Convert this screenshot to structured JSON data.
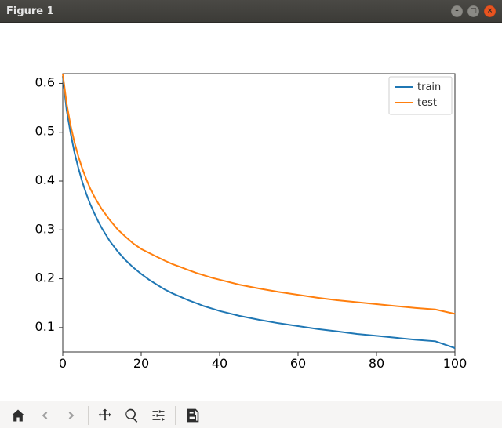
{
  "window": {
    "title": "Figure 1",
    "buttons": {
      "min": "–",
      "max": "▢",
      "close": "×"
    }
  },
  "toolbar": {
    "home": {
      "name": "home-icon",
      "title": "Home"
    },
    "back": {
      "name": "back-icon",
      "title": "Back"
    },
    "forward": {
      "name": "forward-icon",
      "title": "Forward"
    },
    "pan": {
      "name": "move-icon",
      "title": "Pan"
    },
    "zoom": {
      "name": "zoom-icon",
      "title": "Zoom"
    },
    "config": {
      "name": "sliders-icon",
      "title": "Configure subplots"
    },
    "save": {
      "name": "save-icon",
      "title": "Save"
    }
  },
  "chart_data": {
    "type": "line",
    "title": "",
    "xlabel": "",
    "ylabel": "",
    "xlim": [
      0,
      100
    ],
    "ylim": [
      0.05,
      0.62
    ],
    "xticks": [
      0,
      20,
      40,
      60,
      80,
      100
    ],
    "yticks": [
      0.1,
      0.2,
      0.3,
      0.4,
      0.5,
      0.6
    ],
    "x": [
      0,
      1,
      2,
      3,
      4,
      5,
      6,
      7,
      8,
      9,
      10,
      12,
      14,
      16,
      18,
      20,
      22,
      24,
      26,
      28,
      30,
      32,
      34,
      36,
      38,
      40,
      45,
      50,
      55,
      60,
      65,
      70,
      75,
      80,
      85,
      90,
      95,
      100
    ],
    "series": [
      {
        "name": "train",
        "color": "#1f77b4",
        "values": [
          0.615,
          0.545,
          0.498,
          0.458,
          0.426,
          0.398,
          0.374,
          0.353,
          0.335,
          0.318,
          0.303,
          0.277,
          0.256,
          0.238,
          0.223,
          0.21,
          0.198,
          0.188,
          0.178,
          0.17,
          0.163,
          0.156,
          0.15,
          0.144,
          0.139,
          0.134,
          0.124,
          0.116,
          0.109,
          0.103,
          0.097,
          0.092,
          0.087,
          0.083,
          0.079,
          0.075,
          0.072,
          0.058
        ]
      },
      {
        "name": "test",
        "color": "#ff7f0e",
        "values": [
          0.62,
          0.558,
          0.514,
          0.479,
          0.45,
          0.425,
          0.404,
          0.385,
          0.369,
          0.355,
          0.342,
          0.32,
          0.301,
          0.286,
          0.272,
          0.261,
          0.253,
          0.245,
          0.237,
          0.23,
          0.224,
          0.218,
          0.212,
          0.207,
          0.202,
          0.198,
          0.188,
          0.18,
          0.173,
          0.167,
          0.161,
          0.156,
          0.152,
          0.148,
          0.144,
          0.14,
          0.137,
          0.128
        ]
      }
    ],
    "legend": {
      "position": "upper right"
    }
  }
}
